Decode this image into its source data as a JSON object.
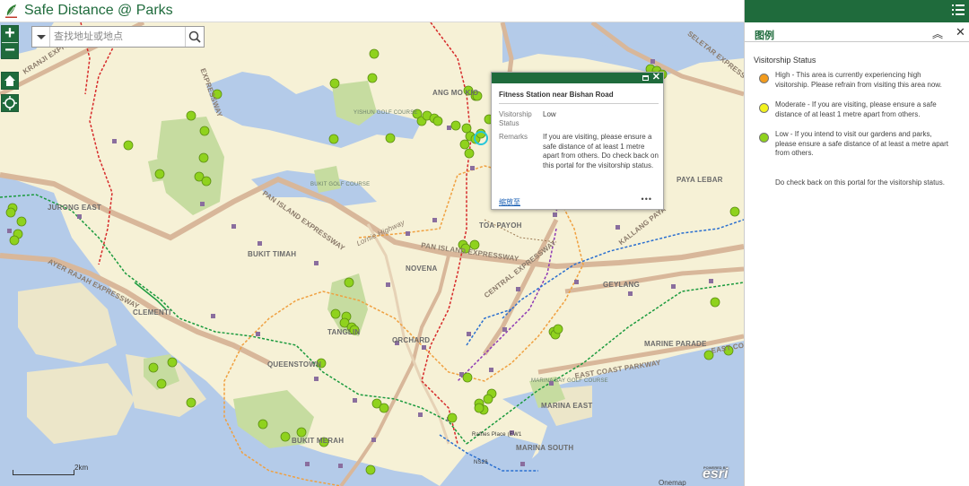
{
  "header": {
    "title": "Safe Distance @ Parks"
  },
  "search": {
    "placeholder": "查找地址或地点"
  },
  "map_labels": {
    "ang_mo_kio": "ANG MO KIO",
    "jurong_east": "JURONG EAST",
    "toa_payoh": "TOA PAYOH",
    "paya_lebar": "PAYA LEBAR",
    "bukit_timah": "BUKIT TIMAH",
    "novena": "NOVENA",
    "geylang": "GEYLANG",
    "clementi": "CLEMENTI",
    "tanglin": "TANGLIN",
    "orchard": "ORCHARD",
    "marine_parade": "MARINE PARADE",
    "queenstown": "QUEENSTOWN",
    "marina_east": "MARINA EAST",
    "marina_south": "MARINA SOUTH",
    "bukit_merah": "BUKIT MERAH",
    "pan_island_expressway": "PAN ISLAND EXPRESSWAY",
    "pan_island_expressway_2": "PAN ISLAND EXPRESSWAY",
    "ayer_rajah_expressway": "AYER RAJAH EXPRESSWAY",
    "central_expressway": "CENTRAL EXPRESSWAY",
    "kallang_paya_lebar": "KALLANG PAYA",
    "east_coast_parkway": "EAST COAST PARKWAY",
    "east_coast": "EAST COA",
    "kranji_expressway": "KRANJI EXPRESSWAY",
    "seletar_expressway": "SELETAR EXPRESSWAY",
    "lornie_highway": "Lornie Highway",
    "yishun": "EXPRESSWAY",
    "raffles_place": "Raffles Place (EW1",
    "ns26": "NS26",
    "golf_yishun": "YISHUN GOLF COURSE",
    "golf_bukit": "BUKIT GOLF COURSE",
    "golf_marina": "MARINA BAY GOLF COURSE"
  },
  "popup": {
    "title": "Fitness Station near Bishan Road",
    "fields": [
      {
        "key": "Visitorship Status",
        "value": "Low"
      },
      {
        "key": "Remarks",
        "value": "If you are visiting, please ensure a safe distance of at least 1 metre apart from others. Do check back on this portal for the visitorship status."
      }
    ],
    "zoom_to": "缩放至",
    "more": "•••"
  },
  "scale_label": "2km",
  "attribution": "Onemap",
  "esri_brand": "esri",
  "esri_powered": "POWERED BY",
  "legend": {
    "title": "图例",
    "layer_name": "Visitorship Status",
    "items": [
      {
        "color": "#f29b1d",
        "text": "High - This area is currently experiencing high visitorship. Please refrain from visiting this area now."
      },
      {
        "color": "#f2f21d",
        "text": "Moderate - If you are visiting, please ensure a safe distance of at least 1 metre apart from others."
      },
      {
        "color": "#8fd21d",
        "text": "Low - If you intend to visit our gardens and parks, please ensure a safe distance of at least a metre apart from others."
      }
    ],
    "note": "Do check back on this portal for the visitorship status."
  },
  "colors": {
    "brand_green": "#1f6b3c",
    "water": "#b4cbe9",
    "land": "#f6f1d6",
    "park": "#c6dca0",
    "marker_low": "#8fd21d",
    "road_major": "#d8b79a"
  }
}
